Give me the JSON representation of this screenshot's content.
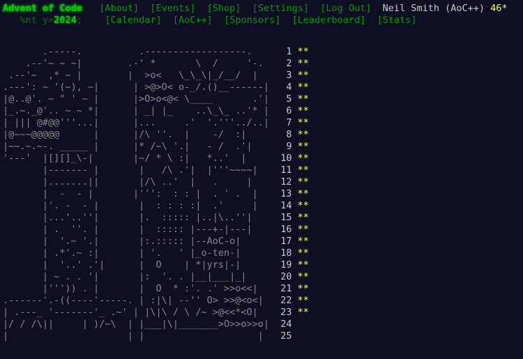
{
  "header": {
    "title": "Advent of Code",
    "nav1": [
      "[About]",
      "[Events]",
      "[Shop]",
      "[Settings]",
      "[Log Out]"
    ],
    "user": "Neil Smith (AoC++)",
    "star_count": "46*",
    "year_prefix": "%nt y=",
    "year": "2024",
    "year_suffix": ";",
    "nav2": [
      "[Calendar]",
      "[AoC++]",
      "[Sponsors]",
      "[Leaderboard]",
      "[Stats]"
    ]
  },
  "calendar": {
    "days": [
      {
        "art": "       .-----.          .------------------.   ",
        "day": " 1",
        "stars": "**"
      },
      {
        "art": "    .--'~ ~ ~|        .-' *       \\  /     '-.",
        "day": " 2",
        "stars": "**"
      },
      {
        "art": " .--'~  ,* ~ |        |  >o<   \\_\\_\\|_/__/  |",
        "day": " 3",
        "stars": "**"
      },
      {
        "art": ".---': ~ '(~), ~|      | >@>O< o-_/.()__------|",
        "day": " 4",
        "stars": "**"
      },
      {
        "art": "|@..@'. ~ \" ' ~ |      |>O>o<@< \\____       .'|",
        "day": " 5",
        "stars": "**"
      },
      {
        "art": "|_.~._@'.. ~ ~ *|      | _| |_    ..\\_\\_ ..'* |",
        "day": " 6",
        "stars": "**"
      },
      {
        "art": "| ||| @#@@'''...|      |...     .'  '.'''../..|",
        "day": " 7",
        "stars": "**"
      },
      {
        "art": "|@~~~@@@@@      |      |/\\ ''.  |    -/  :|",
        "day": " 8",
        "stars": "**"
      },
      {
        "art": "|~~.~.~-. _____ |      |* /~\\ '.|   - /  .'|",
        "day": " 9",
        "stars": "**"
      },
      {
        "art": "'---'  |[][]_\\-|       |~/ * \\ :|   *..'  |",
        "day": "10",
        "stars": "**"
      },
      {
        "art": "       |------- |       |   /\\ .'|  |'''~~~~|",
        "day": "11",
        "stars": "**"
      },
      {
        "art": "       |.......||       |/\\ ..'  |   .     |",
        "day": "12",
        "stars": "**"
      },
      {
        "art": "       |  -  - |       |''':  : : |  . ' .  |",
        "day": "13",
        "stars": "**"
      },
      {
        "art": "       |'. -  - |       |  : : : :|  .'     |",
        "day": "14",
        "stars": "**"
      },
      {
        "art": "       |...'..''|       |.  ::::: |..|\\..''|",
        "day": "15",
        "stars": "**"
      },
      {
        "art": "       | .  ''. |       |  ::::: |---+-|---|",
        "day": "16",
        "stars": "**"
      },
      {
        "art": "       |  '.~ '.|       |:.::::: |--AoC-o|",
        "day": "17",
        "stars": "**"
      },
      {
        "art": "       | .*'.~ :|       | '.   ' |_o-ten-|",
        "day": "18",
        "stars": "**"
      },
      {
        "art": "       |  '..' .'|      |  O    | *|yrs|-|",
        "day": "19",
        "stars": "**"
      },
      {
        "art": "       | ~ . . '|       |:  '. . |__|___|_|",
        "day": "20",
        "stars": "**"
      },
      {
        "art": "       |''')) . |       |  O  * :'. .' >>o<<|",
        "day": "21",
        "stars": "**"
      },
      {
        "art": ".------'.-((----'-----. | :|\\| --'' O> >>@<o<|",
        "day": "22",
        "stars": "**"
      },
      {
        "art": "| .---_ '-------'_ .~' | |\\|\\ / \\ /~ >@<<*<O|",
        "day": "23",
        "stars": "**"
      },
      {
        "art": "|/ / /\\||     | )/~\\  | |___|\\|_______>O>>o>>o|",
        "day": "24",
        "stars": ""
      },
      {
        "art": "|                     | |                    |",
        "day": "25",
        "stars": ""
      }
    ]
  },
  "colors": {
    "background": "#0f0f23",
    "title": "#00cc00",
    "nav": "#009900",
    "star": "#ffff66",
    "text": "#cccccc"
  }
}
